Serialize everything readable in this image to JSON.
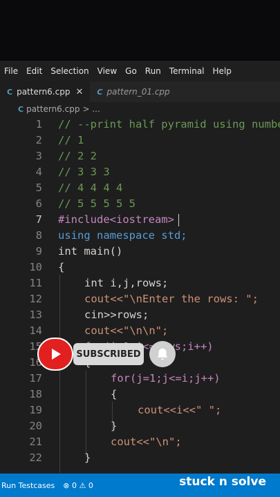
{
  "menu": [
    "File",
    "Edit",
    "Selection",
    "View",
    "Go",
    "Run",
    "Terminal",
    "Help"
  ],
  "tabs": [
    {
      "label": "pattern6.cpp",
      "icon": "C"
    },
    {
      "label": "pattern_01.cpp",
      "icon": "C"
    }
  ],
  "breadcrumb": {
    "file": "pattern6.cpp",
    "sep": "> ..."
  },
  "lines": [
    {
      "n": "1",
      "t": "// --print half pyramid using numbers"
    },
    {
      "n": "2",
      "t": "// 1"
    },
    {
      "n": "3",
      "t": "// 2 2"
    },
    {
      "n": "4",
      "t": "// 3 3 3"
    },
    {
      "n": "5",
      "t": "// 4 4 4 4"
    },
    {
      "n": "6",
      "t": "// 5 5 5 5 5"
    },
    {
      "n": "7",
      "t": "#include<iostream>"
    },
    {
      "n": "8",
      "t": "using namespace std;"
    },
    {
      "n": "9",
      "t": "int main()"
    },
    {
      "n": "10",
      "t": "{"
    },
    {
      "n": "11",
      "t": "int i,j,rows;"
    },
    {
      "n": "12",
      "t": "cout<<\"\\nEnter the rows: \";"
    },
    {
      "n": "13",
      "t": "cin>>rows;"
    },
    {
      "n": "14",
      "t": "cout<<\"\\n\\n\";"
    },
    {
      "n": "15",
      "t": "for(i=1;i<=rows;i++)"
    },
    {
      "n": "16",
      "t": "{"
    },
    {
      "n": "17",
      "t": "for(j=1;j<=i;j++)"
    },
    {
      "n": "18",
      "t": "{"
    },
    {
      "n": "19",
      "t": "cout<<i<<\" \";"
    },
    {
      "n": "20",
      "t": "}"
    },
    {
      "n": "21",
      "t": "cout<<\"\\n\";"
    },
    {
      "n": "22",
      "t": "}"
    }
  ],
  "overlay": {
    "subscribed": "SUBSCRIBED"
  },
  "status": {
    "testcases": "Run Testcases",
    "problems": "⊗ 0 ⚠ 0"
  },
  "watermark": "stuck n solve"
}
